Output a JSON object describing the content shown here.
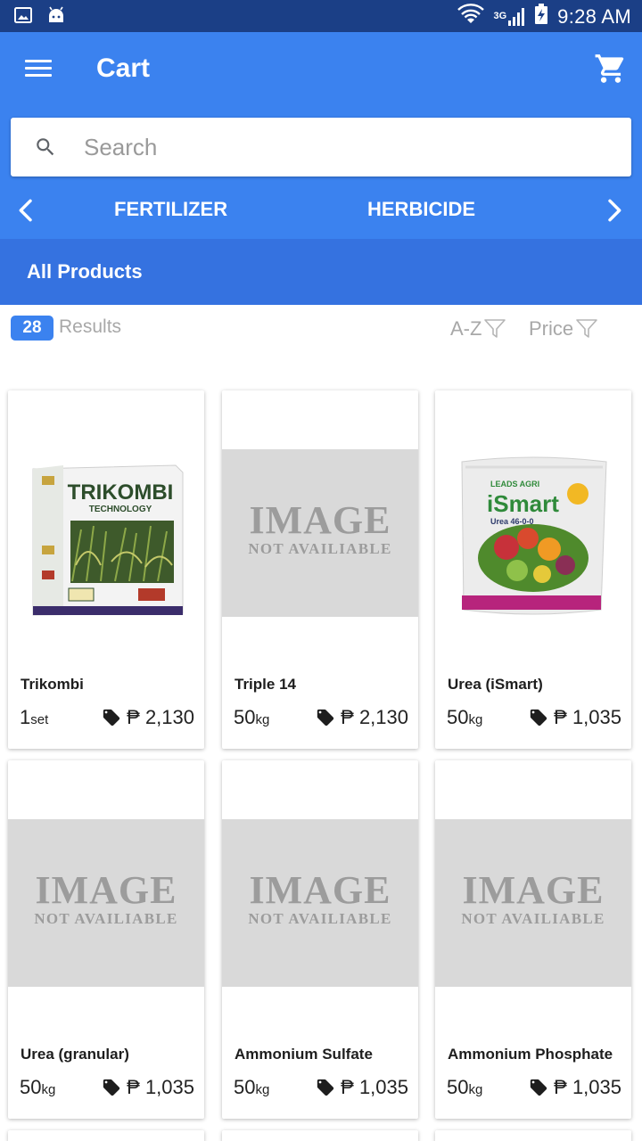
{
  "status_bar": {
    "network": "3G",
    "time": "9:28 AM"
  },
  "appbar": {
    "title": "Cart"
  },
  "search": {
    "placeholder": "Search"
  },
  "categories": {
    "tabs": [
      "FERTILIZER",
      "HERBICIDE"
    ]
  },
  "subheader": {
    "label": "All Products"
  },
  "results": {
    "count": "28",
    "label": "Results",
    "sort_az": "A-Z",
    "sort_price": "Price"
  },
  "placeholder_image": {
    "line1": "IMAGE",
    "line2": "NOT AVAILIABLE"
  },
  "products": [
    {
      "name": "Trikombi",
      "qty": "1",
      "unit": "set",
      "price": "₱ 2,130",
      "image": "trikombi-box"
    },
    {
      "name": "Triple 14",
      "qty": "50",
      "unit": "kg",
      "price": "₱ 2,130",
      "image": "none"
    },
    {
      "name": "Urea (iSmart)",
      "qty": "50",
      "unit": "kg",
      "price": "₱ 1,035",
      "image": "ismart-bag"
    },
    {
      "name": "Urea (granular)",
      "qty": "50",
      "unit": "kg",
      "price": "₱ 1,035",
      "image": "none"
    },
    {
      "name": "Ammonium Sulfate",
      "qty": "50",
      "unit": "kg",
      "price": "₱ 1,035",
      "image": "none"
    },
    {
      "name": "Ammonium Phosphate",
      "qty": "50",
      "unit": "kg",
      "price": "₱ 1,035",
      "image": "none"
    }
  ],
  "product_art": {
    "trikombi_brand": "TRIKOMBI",
    "trikombi_sub": "TECHNOLOGY",
    "ismart_brand": "iSmart",
    "ismart_sub": "Urea 46-0-0"
  },
  "colors": {
    "primary": "#3b82ef",
    "primary_dark": "#3572e0",
    "status_bar": "#1b3f86"
  }
}
